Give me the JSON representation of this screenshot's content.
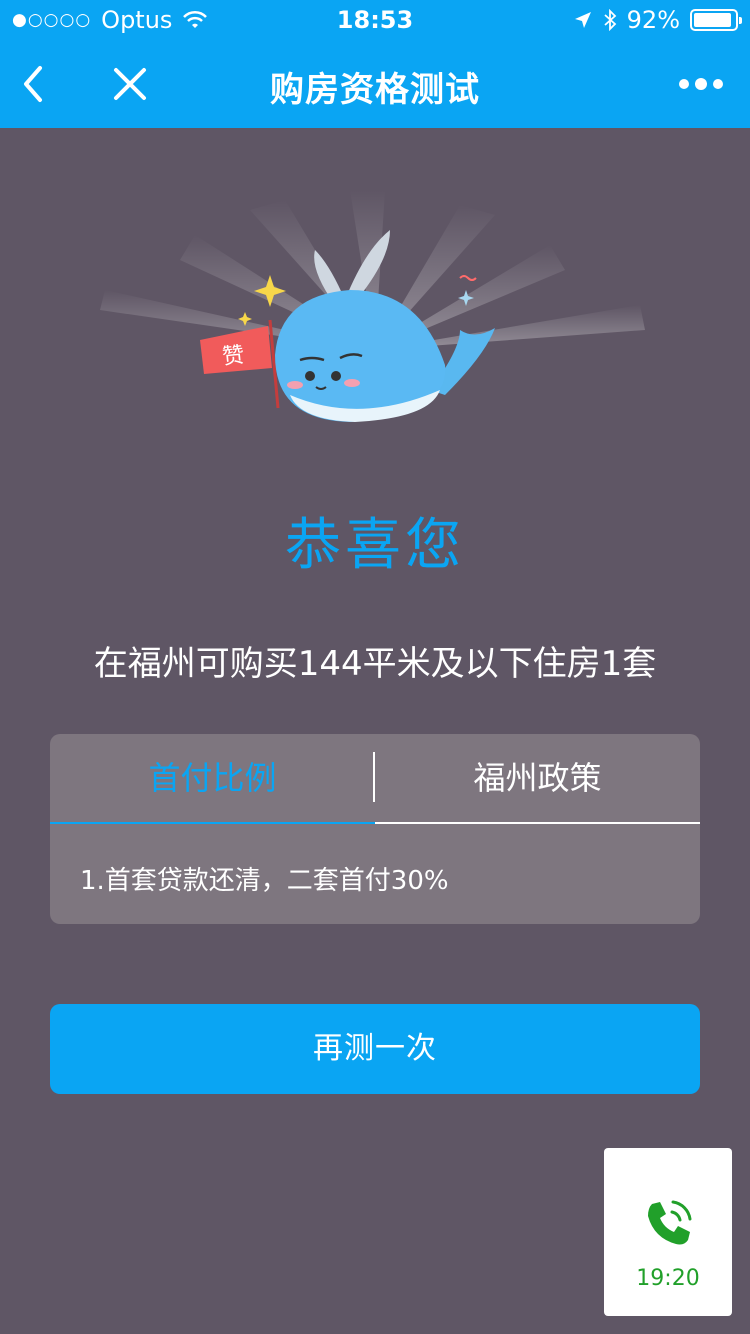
{
  "status_bar": {
    "signal": "●○○○○",
    "carrier": "Optus",
    "time": "18:53",
    "battery": "92%",
    "battery_level": 0.92
  },
  "nav": {
    "title": "购房资格测试",
    "back_icon": "chevron-left-icon",
    "close_icon": "close-icon",
    "more_icon": "more-dots-icon"
  },
  "hero": {
    "flag_text": "赞",
    "icon": "whale-mascot-illustration"
  },
  "main": {
    "congrats": "恭喜您",
    "result": "在福州可购买144平米及以下住房1套"
  },
  "card": {
    "tabs": [
      {
        "label": "首付比例",
        "active": true
      },
      {
        "label": "福州政策",
        "active": false
      }
    ],
    "content": "1.首套贷款还清，二套首付30%"
  },
  "retry_button": "再测一次",
  "call_widget": {
    "icon": "phone-call-icon",
    "time": "19:20"
  },
  "colors": {
    "accent": "#0aa5f3",
    "background": "#5f5665",
    "card": "#7e767f",
    "call_green": "#21a02a"
  }
}
